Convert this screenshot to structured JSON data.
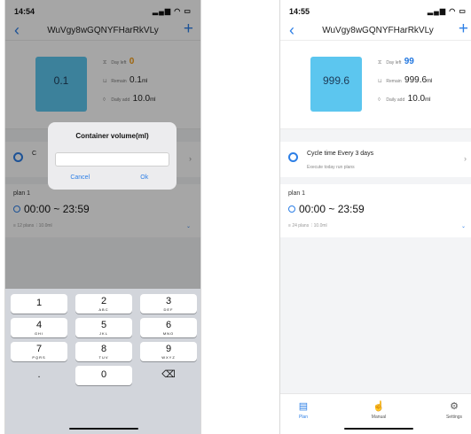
{
  "left_screen": {
    "status_time": "14:54",
    "device_title": "WuVgy8wGQNYFHarRkVLy",
    "tank_value": "0.1",
    "stats": {
      "day_left_label": "Day left",
      "day_left_value": "0",
      "remain_label": "Remain",
      "remain_value": "0.1",
      "remain_unit": "ml",
      "daily_add_label": "Daily add",
      "daily_add_value": "10.0",
      "daily_add_unit": "ml"
    },
    "cycle_title_partial": "C",
    "plan": {
      "name": "plan 1",
      "time_range": "00:00 ~ 23:59",
      "meta_plans": "12 plans",
      "meta_volume": "10.0ml"
    },
    "dialog": {
      "title": "Container volume(ml)",
      "input_value": "",
      "cancel_label": "Cancel",
      "ok_label": "Ok"
    },
    "keypad": [
      {
        "num": "1",
        "letters": ""
      },
      {
        "num": "2",
        "letters": "ABC"
      },
      {
        "num": "3",
        "letters": "DEF"
      },
      {
        "num": "4",
        "letters": "GHI"
      },
      {
        "num": "5",
        "letters": "JKL"
      },
      {
        "num": "6",
        "letters": "MNO"
      },
      {
        "num": "7",
        "letters": "PQRS"
      },
      {
        "num": "8",
        "letters": "TUV"
      },
      {
        "num": "9",
        "letters": "WXYZ"
      },
      {
        "num": ".",
        "letters": ""
      },
      {
        "num": "0",
        "letters": ""
      },
      {
        "num": "⌫",
        "letters": ""
      }
    ]
  },
  "right_screen": {
    "status_time": "14:55",
    "device_title": "WuVgy8wGQNYFHarRkVLy",
    "tank_value": "999.6",
    "stats": {
      "day_left_label": "Day left",
      "day_left_value": "99",
      "remain_label": "Remain",
      "remain_value": "999.6",
      "remain_unit": "ml",
      "daily_add_label": "Daily add",
      "daily_add_value": "10.0",
      "daily_add_unit": "ml"
    },
    "cycle": {
      "title": "Cycle time   Every 3 days",
      "subtitle": "Execute today run plans"
    },
    "plan": {
      "name": "plan 1",
      "time_range": "00:00 ~ 23:59",
      "meta_plans": "24 plans",
      "meta_volume": "10.0ml"
    },
    "tabs": {
      "plan": "Plan",
      "manual": "Manual",
      "settings": "Settings"
    }
  },
  "colors": {
    "accent_blue": "#2d7fe6",
    "tank_fill": "#5cc6ef",
    "day_left_zero": "#f39b12",
    "day_left_ok": "#2277e0"
  }
}
